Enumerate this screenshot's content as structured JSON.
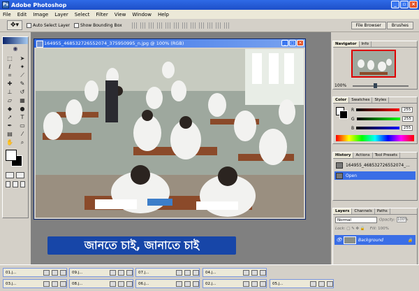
{
  "app": {
    "title": "Adobe Photoshop",
    "logo": "Ps"
  },
  "menu": [
    "File",
    "Edit",
    "Image",
    "Layer",
    "Select",
    "Filter",
    "View",
    "Window",
    "Help"
  ],
  "options": {
    "auto_select": "Auto Select Layer",
    "bounding_box": "Show Bounding Box"
  },
  "palette_well": [
    "File Browser",
    "Brushes"
  ],
  "document": {
    "title": "164955_468532726552074_375950995_n.jpg @ 100% (RGB)"
  },
  "banner": {
    "text": "জানতে চাই, জানাতে চাই"
  },
  "navigator": {
    "tabs": [
      "Navigator",
      "Info"
    ],
    "zoom": "100%"
  },
  "color": {
    "tabs": [
      "Color",
      "Swatches",
      "Styles"
    ],
    "channels": [
      {
        "label": "R",
        "value": "255"
      },
      {
        "label": "G",
        "value": "255"
      },
      {
        "label": "B",
        "value": "255"
      }
    ]
  },
  "history": {
    "tabs": [
      "History",
      "Actions",
      "Tool Presets"
    ],
    "items": [
      "164955_468532726552074_...",
      "Open"
    ]
  },
  "layers": {
    "tabs": [
      "Layers",
      "Channels",
      "Paths"
    ],
    "blend": "Normal",
    "opacity_label": "Opacity:",
    "opacity": "100%",
    "lock_label": "Lock:",
    "fill_label": "Fill:",
    "fill": "100%",
    "layer_name": "Background"
  },
  "taskbar_docs": [
    "01.j...",
    "09.j...",
    "07.j...",
    "04.j...",
    "03.j...",
    "08.j...",
    "06.j...",
    "02.j...",
    "05.j..."
  ]
}
